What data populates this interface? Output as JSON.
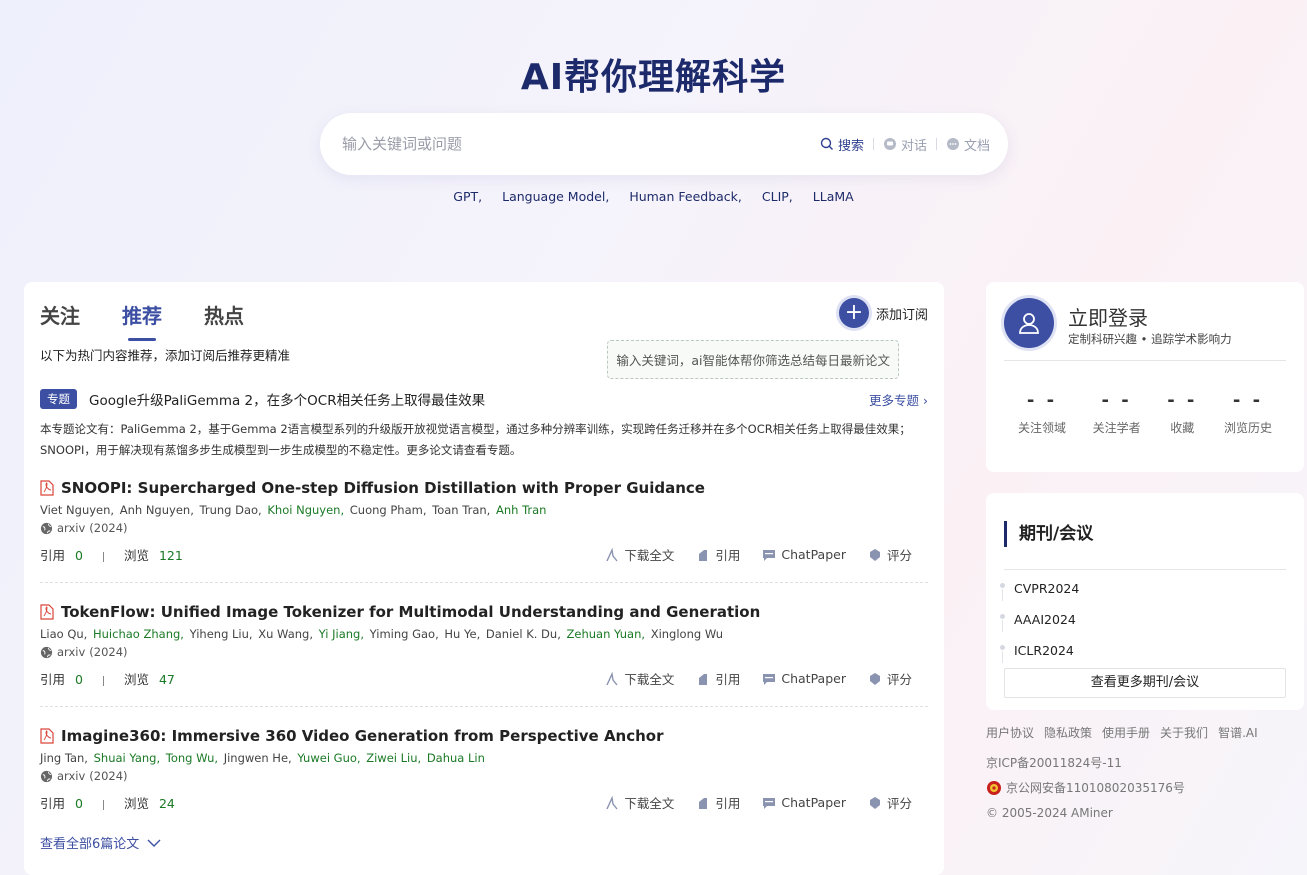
{
  "hero": {
    "title": "AI帮你理解科学"
  },
  "search": {
    "placeholder": "输入关键词或问题",
    "modes": [
      {
        "label": "搜索",
        "icon": "search-icon",
        "active": true
      },
      {
        "label": "对话",
        "icon": "chat-icon",
        "active": false
      },
      {
        "label": "文档",
        "icon": "document-icon",
        "active": false
      }
    ]
  },
  "hot_tags": [
    "GPT,",
    "Language Model,",
    "Human Feedback,",
    "CLIP,",
    "LLaMA"
  ],
  "main": {
    "tabs": [
      {
        "label": "关注",
        "active": false
      },
      {
        "label": "推荐",
        "active": true
      },
      {
        "label": "热点",
        "active": false
      }
    ],
    "add_subscription": "添加订阅",
    "subscription_tip": "输入关键词，ai智能体帮你筛选总结每日最新论文",
    "recommend_note": "以下为热门内容推荐，添加订阅后推荐更精准",
    "topic": {
      "badge": "专题",
      "title": "Google升级PaliGemma 2，在多个OCR相关任务上取得最佳效果",
      "more": "更多专题",
      "description": "本专题论文有：PaliGemma 2，基于Gemma 2语言模型系列的升级版开放视觉语言模型，通过多种分辨率训练，实现跨任务迁移并在多个OCR相关任务上取得最佳效果；SNOOPI，用于解决现有蒸馏多步生成模型到一步生成模型的不稳定性。更多论文请查看专题。"
    },
    "papers": [
      {
        "title": "SNOOPI: Supercharged One-step Diffusion Distillation with Proper Guidance",
        "authors": [
          {
            "name": "Viet Nguyen,",
            "linked": false
          },
          {
            "name": "Anh Nguyen,",
            "linked": false
          },
          {
            "name": "Trung Dao,",
            "linked": false
          },
          {
            "name": "Khoi Nguyen,",
            "linked": true
          },
          {
            "name": "Cuong Pham,",
            "linked": false
          },
          {
            "name": "Toan Tran,",
            "linked": false
          },
          {
            "name": "Anh Tran",
            "linked": true
          }
        ],
        "venue": "arxiv",
        "year": "(2024)",
        "citations": "0",
        "views": "121"
      },
      {
        "title": "TokenFlow: Unified Image Tokenizer for Multimodal Understanding and Generation",
        "authors": [
          {
            "name": "Liao Qu,",
            "linked": false
          },
          {
            "name": "Huichao Zhang,",
            "linked": true
          },
          {
            "name": "Yiheng Liu,",
            "linked": false
          },
          {
            "name": "Xu Wang,",
            "linked": false
          },
          {
            "name": "Yi Jiang,",
            "linked": true
          },
          {
            "name": "Yiming Gao,",
            "linked": false
          },
          {
            "name": "Hu Ye,",
            "linked": false
          },
          {
            "name": "Daniel K. Du,",
            "linked": false
          },
          {
            "name": "Zehuan Yuan,",
            "linked": true
          },
          {
            "name": "Xinglong Wu",
            "linked": false
          }
        ],
        "venue": "arxiv",
        "year": "(2024)",
        "citations": "0",
        "views": "47"
      },
      {
        "title": "Imagine360: Immersive 360 Video Generation from Perspective Anchor",
        "authors": [
          {
            "name": "Jing Tan,",
            "linked": false
          },
          {
            "name": "Shuai Yang,",
            "linked": true
          },
          {
            "name": "Tong Wu,",
            "linked": true
          },
          {
            "name": "Jingwen He,",
            "linked": false
          },
          {
            "name": "Yuwei Guo,",
            "linked": true
          },
          {
            "name": "Ziwei Liu,",
            "linked": true
          },
          {
            "name": "Dahua Lin",
            "linked": true
          }
        ],
        "venue": "arxiv",
        "year": "(2024)",
        "citations": "0",
        "views": "24"
      }
    ],
    "labels": {
      "citations": "引用",
      "views": "浏览",
      "download": "下载全文",
      "cite": "引用",
      "chatpaper": "ChatPaper",
      "rate": "评分"
    },
    "see_all": "查看全部6篇论文"
  },
  "login": {
    "title": "立即登录",
    "subtitle": "定制科研兴趣 • 追踪学术影响力",
    "stats": [
      {
        "value": "- -",
        "label": "关注领域"
      },
      {
        "value": "- -",
        "label": "关注学者"
      },
      {
        "value": "- -",
        "label": "收藏"
      },
      {
        "value": "- -",
        "label": "浏览历史"
      }
    ]
  },
  "conferences": {
    "title": "期刊/会议",
    "items": [
      "CVPR2024",
      "AAAI2024",
      "ICLR2024"
    ],
    "more": "查看更多期刊/会议"
  },
  "footer": {
    "links": [
      "用户协议",
      "隐私政策",
      "使用手册",
      "关于我们",
      "智谱.AI"
    ],
    "icp": "京ICP备20011824号-11",
    "police": "京公网安备11010802035176号",
    "copyright": "© 2005-2024 AMiner"
  },
  "colors": {
    "primary": "#3c4fa2",
    "title": "#1c2a6b",
    "author_link": "#1a7a25"
  }
}
